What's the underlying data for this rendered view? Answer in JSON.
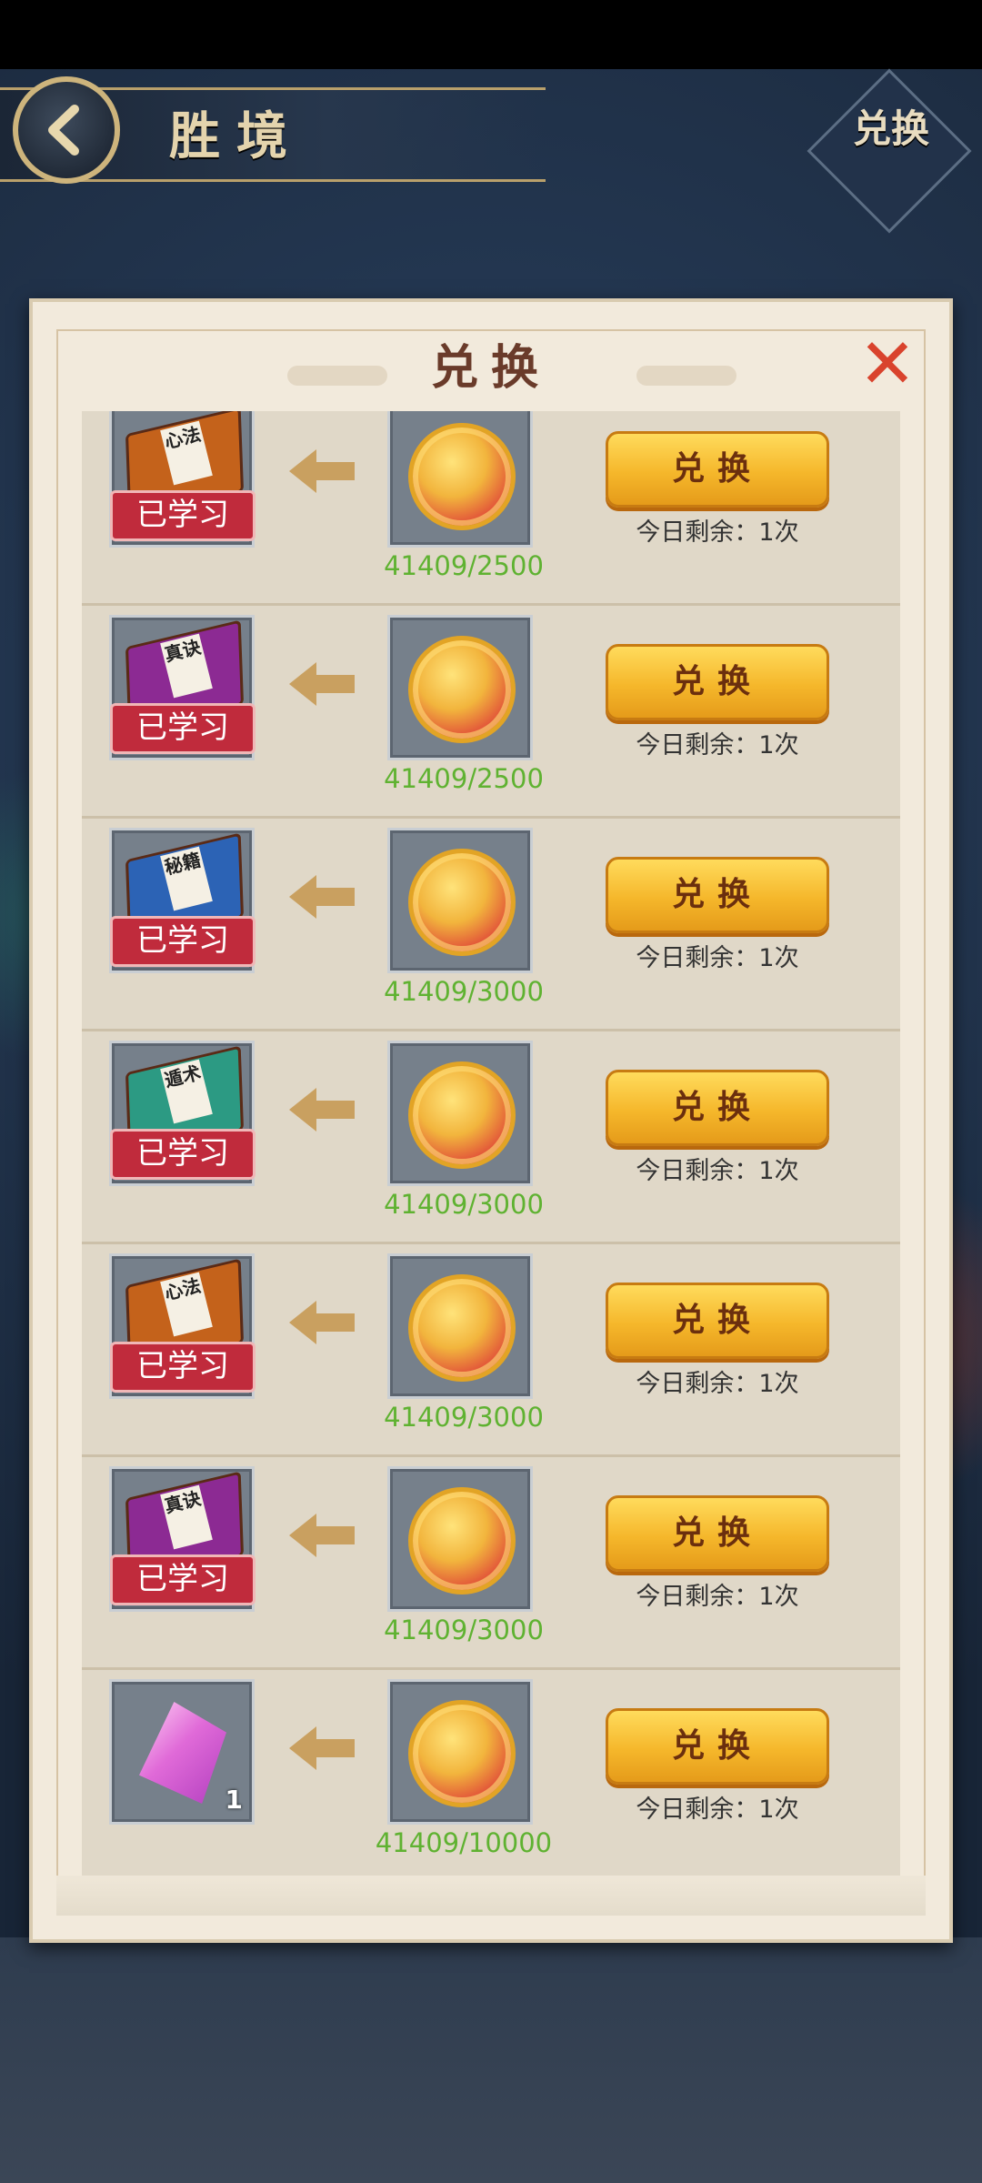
{
  "header": {
    "title": "胜境",
    "exchange_corner_label": "兑换"
  },
  "dialog": {
    "title": "兑换",
    "close_label": "✕"
  },
  "colors": {
    "amount_green": "#5fb231",
    "learned_red": "#c02b3c",
    "button_gold": "#f5b72b"
  },
  "rows": [
    {
      "item_icon": "book-icon",
      "book_color": "#c4621b",
      "book_text": "心法",
      "badge": "已学习",
      "cost_icon": "coin-icon",
      "amount": "41409/2500",
      "button": "兑换",
      "remaining": "今日剩余：1次"
    },
    {
      "item_icon": "book-icon",
      "book_color": "#8c2a93",
      "book_text": "真诀",
      "badge": "已学习",
      "cost_icon": "coin-icon",
      "amount": "41409/2500",
      "button": "兑换",
      "remaining": "今日剩余：1次"
    },
    {
      "item_icon": "book-icon",
      "book_color": "#2c63b5",
      "book_text": "秘籍",
      "badge": "已学习",
      "cost_icon": "coin-icon",
      "amount": "41409/3000",
      "button": "兑换",
      "remaining": "今日剩余：1次"
    },
    {
      "item_icon": "book-icon",
      "book_color": "#2c9a83",
      "book_text": "遁术",
      "badge": "已学习",
      "cost_icon": "coin-icon",
      "amount": "41409/3000",
      "button": "兑换",
      "remaining": "今日剩余：1次"
    },
    {
      "item_icon": "book-icon",
      "book_color": "#c4621b",
      "book_text": "心法",
      "badge": "已学习",
      "cost_icon": "coin-icon",
      "amount": "41409/3000",
      "button": "兑换",
      "remaining": "今日剩余：1次"
    },
    {
      "item_icon": "book-icon",
      "book_color": "#8c2a93",
      "book_text": "真诀",
      "badge": "已学习",
      "cost_icon": "coin-icon",
      "amount": "41409/3000",
      "button": "兑换",
      "remaining": "今日剩余：1次"
    },
    {
      "item_icon": "crystal-icon",
      "item_count": "1",
      "cost_icon": "coin-icon",
      "amount": "41409/10000",
      "button": "兑换",
      "remaining": "今日剩余：1次"
    }
  ]
}
